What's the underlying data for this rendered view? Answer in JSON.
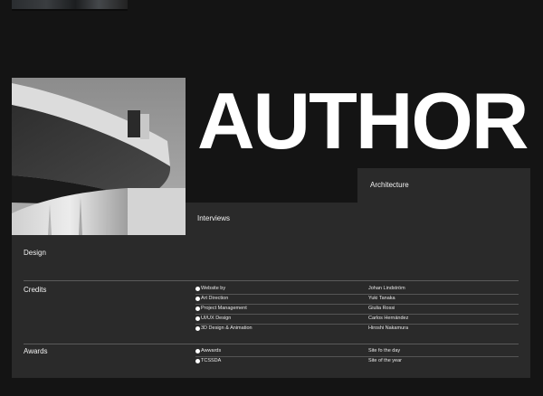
{
  "hero": {
    "title": "AUTHOR"
  },
  "panels": {
    "architecture": "Architecture",
    "interviews": "Interviews",
    "design": "Design"
  },
  "credits": {
    "label": "Credits",
    "rows": [
      {
        "role": "Website by",
        "name": "Johan Lindström"
      },
      {
        "role": "Art Direction",
        "name": "Yuki Tanaka"
      },
      {
        "role": "Project Management",
        "name": "Giulia Rossi"
      },
      {
        "role": "UI/UX Design",
        "name": "Carlos Hernández"
      },
      {
        "role": "3D Design & Animation",
        "name": "Hiroshi Nakamura"
      }
    ]
  },
  "awards": {
    "label": "Awards",
    "rows": [
      {
        "role": "Awwards",
        "name": "Site fo the day"
      },
      {
        "role": "TCSSDA",
        "name": "Site of the year"
      }
    ]
  },
  "colors": {
    "background": "#141414",
    "panel": "#2a2a2a",
    "text": "#ffffff"
  }
}
